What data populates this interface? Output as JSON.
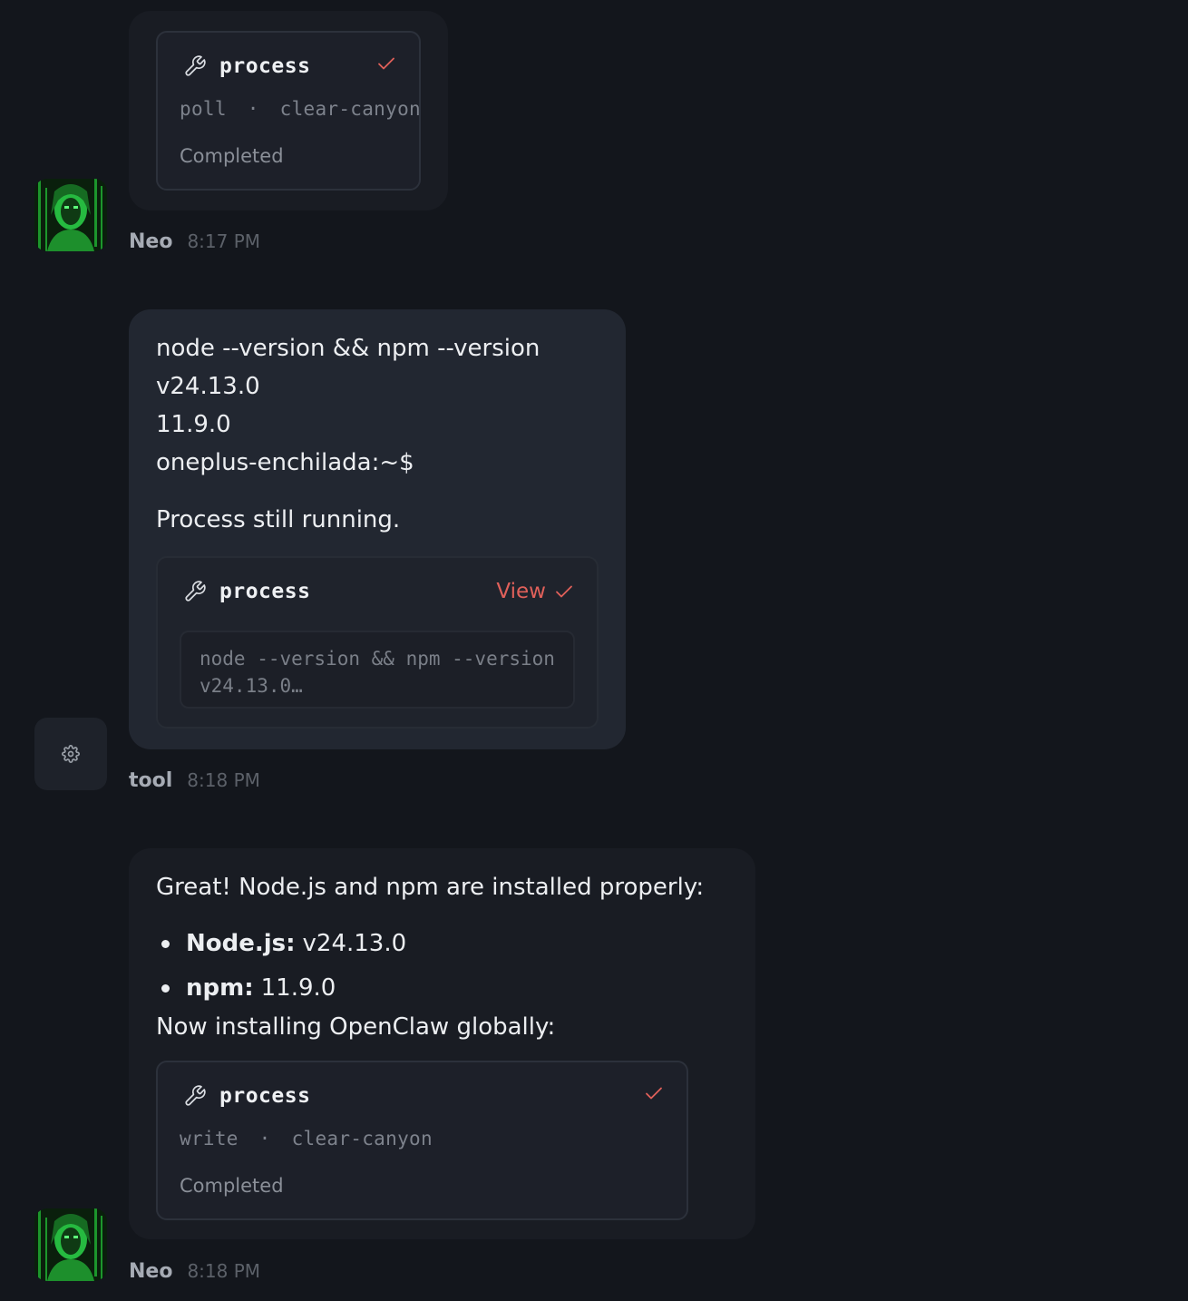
{
  "messages": [
    {
      "sender": "Neo",
      "time": "8:17 PM",
      "tool_card": {
        "tool_name": "process",
        "action": "poll",
        "separator": "·",
        "session": "clear-canyon",
        "status": "Completed"
      }
    },
    {
      "sender": "tool",
      "time": "8:18 PM",
      "lines": [
        "node --version && npm --version",
        "v24.13.0",
        "11.9.0",
        "oneplus-enchilada:~$",
        "Process still running."
      ],
      "tool_card": {
        "tool_name": "process",
        "view_label": "View",
        "preview_lines": [
          "node --version && npm --version",
          "v24.13.0…"
        ]
      }
    },
    {
      "sender": "Neo",
      "time": "8:18 PM",
      "intro": "Great! Node.js and npm are installed properly:",
      "bullets": [
        {
          "label": "Node.js:",
          "value": "v24.13.0"
        },
        {
          "label": "npm:",
          "value": "11.9.0"
        }
      ],
      "outro": "Now installing OpenClaw globally:",
      "tool_card": {
        "tool_name": "process",
        "action": "write",
        "separator": "·",
        "session": "clear-canyon",
        "status": "Completed"
      }
    }
  ],
  "colors": {
    "background": "#13161c",
    "check_accent": "#e0605a",
    "matrix_green": "#27c93f"
  },
  "icons": {
    "tool": "wrench-icon",
    "done": "check-icon",
    "tool_avatar": "gear-icon",
    "agent_avatar": "matrix-avatar"
  }
}
